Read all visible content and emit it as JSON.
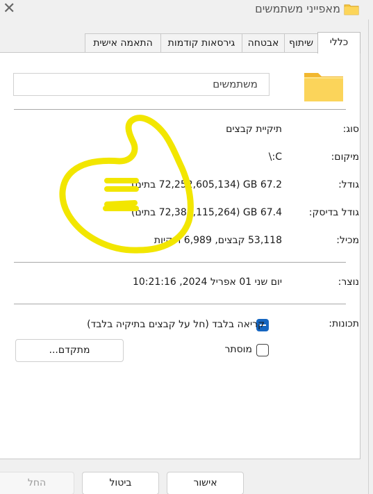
{
  "window": {
    "title": "מאפייני משתמשים",
    "close_glyph": "✕"
  },
  "tabs": [
    "כללי",
    "שיתוף",
    "אבטחה",
    "גירסאות קודמות",
    "התאמה אישית"
  ],
  "general": {
    "name_value": "משתמשים",
    "rows": [
      {
        "label": "סוג:",
        "value": "תיקיית קבצים"
      },
      {
        "label": "מיקום:",
        "value": "C:\\"
      },
      {
        "label": "גודל:",
        "value": "67.2 GB (72,252,605,134 בתים)"
      },
      {
        "label": "גודל בדיסק:",
        "value": "67.4 GB (72,383,115,264 בתים)"
      },
      {
        "label": "מכיל:",
        "value": "53,118 קבצים, 6,989 תיקיות"
      },
      {
        "label": "נוצר:",
        "value": "יום שני 01 אפריל 2024, 10:21:16"
      }
    ],
    "attributes_label": "תכונות:",
    "readonly_label": "קריאה בלבד (חל על קבצים בתיקיה בלבד)",
    "hidden_label": "מוסתר",
    "advanced_button": "מתקדם..."
  },
  "footer": {
    "ok": "אישור",
    "cancel": "ביטול",
    "apply": "החל"
  },
  "colors": {
    "accent": "#1565c0",
    "annotation": "#f2e600"
  }
}
